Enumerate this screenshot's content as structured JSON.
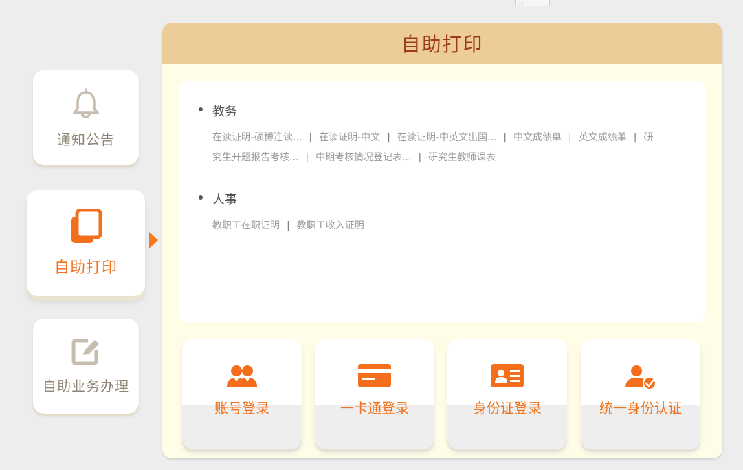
{
  "colors": {
    "accent_orange": "#f0721c",
    "header_tan": "#eccc99",
    "title_brown": "#9b3a1c",
    "panel_cream": "#fffde8",
    "muted_icon": "#c7bdae"
  },
  "sidebar": {
    "items": [
      {
        "label": "通知公告",
        "icon": "bell-icon",
        "active": false
      },
      {
        "label": "自助打印",
        "icon": "copy-icon",
        "active": true
      },
      {
        "label": "自助业务办理",
        "icon": "edit-icon",
        "active": false
      }
    ]
  },
  "panel": {
    "title": "自助打印",
    "sections": [
      {
        "title": "教务",
        "links": [
          "在读证明-硕博连读...",
          "在读证明-中文",
          "在读证明-中英文出国...",
          "中文成绩单",
          "英文成绩单",
          "研究生开题报告考核...",
          "中期考核情况登记表...",
          "研究生教师课表"
        ]
      },
      {
        "title": "人事",
        "links": [
          "教职工在职证明",
          "教职工收入证明"
        ]
      }
    ],
    "separator": "|"
  },
  "login_tiles": [
    {
      "label": "账号登录",
      "icon": "users-icon"
    },
    {
      "label": "一卡通登录",
      "icon": "card-icon"
    },
    {
      "label": "身份证登录",
      "icon": "id-card-icon"
    },
    {
      "label": "统一身份认证",
      "icon": "user-check-icon"
    }
  ]
}
